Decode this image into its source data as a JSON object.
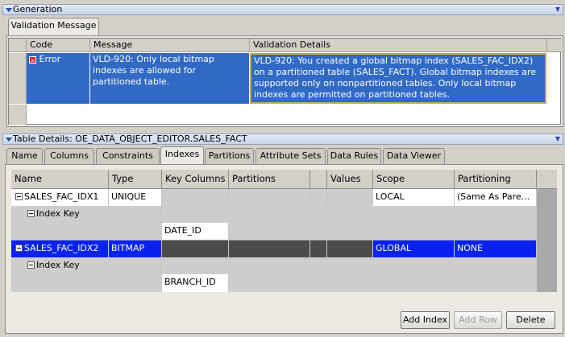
{
  "generation": {
    "header": "Generation",
    "tab": "Validation Message",
    "columns": [
      "Code",
      "Message",
      "Validation Details"
    ],
    "row": {
      "code": "Error",
      "message": "VLD-920: Only local bitmap indexes are allowed for partitioned table.",
      "details": "VLD-920: You created a global bitmap index (SALES_FAC_IDX2) on a partitioned table (SALES_FACT). Global bitmap indexes are supported only on nonpartitioned tables. Only local bitmap indexes are permitted on partitioned tables."
    }
  },
  "details": {
    "header": "Table Details: OE_DATA_OBJECT_EDITOR.SALES_FACT",
    "tabs": [
      "Name",
      "Columns",
      "Constraints",
      "Indexes",
      "Partitions",
      "Attribute Sets",
      "Data Rules",
      "Data Viewer"
    ],
    "active_tab": "Indexes",
    "columns": [
      "Name",
      "Type",
      "Key Columns",
      "Partitions",
      "",
      "Values",
      "Scope",
      "Partitioning"
    ],
    "rows": [
      {
        "name": "SALES_FAC_IDX1",
        "type": "UNIQUE",
        "scope": "LOCAL",
        "partitioning": "(Same As Pare...",
        "index_key_label": "Index Key",
        "key_column": "DATE_ID"
      },
      {
        "name": "SALES_FAC_IDX2",
        "type": "BITMAP",
        "scope": "GLOBAL",
        "partitioning": "NONE",
        "index_key_label": "Index Key",
        "key_column": "BRANCH_ID"
      }
    ],
    "buttons": {
      "add_index": "Add Index",
      "add_row": "Add Row",
      "delete": "Delete"
    }
  }
}
